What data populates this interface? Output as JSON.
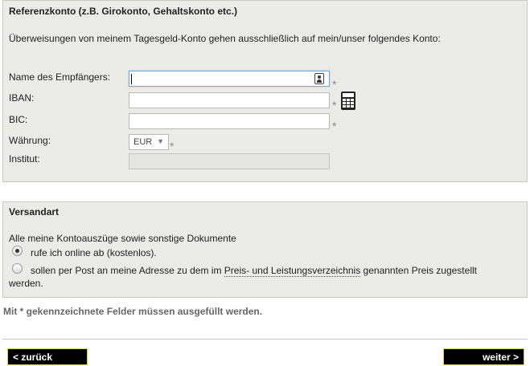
{
  "referenz": {
    "heading": "Referenzkonto (z.B. Girokonto, Gehaltskonto etc.)",
    "intro": "Überweisungen von meinem Tagesgeld-Konto gehen ausschließlich auf mein/unser folgendes Konto:",
    "fields": {
      "name_label": "Name des Empfängers:",
      "name_value": "",
      "iban_label": "IBAN:",
      "iban_value": "",
      "bic_label": "BIC:",
      "bic_value": "",
      "waehrung_label": "Währung:",
      "waehrung_value": "EUR",
      "institut_label": "Institut:",
      "institut_value": ""
    },
    "required_mark": "*"
  },
  "versand": {
    "heading": "Versandart",
    "intro": "Alle meine Kontoauszüge sowie sonstige Dokumente",
    "option_online": "rufe ich online ab (kostenlos).",
    "option_online_selected": true,
    "option_post_pre": "sollen per Post an meine Adresse zu dem im ",
    "option_post_link": "Preis- und Leistungsverzeichnis",
    "option_post_post": " genannten Preis zugestellt",
    "option_post_line2": "werden.",
    "option_post_selected": false
  },
  "note": {
    "pre": "Mit ",
    "star": "*",
    "post": " gekennzeichnete Felder müssen ausgefüllt werden."
  },
  "nav": {
    "back_label": "< zurück",
    "next_label": "weiter >"
  },
  "icons": {
    "contact": "contact-card-icon",
    "calculator": "calculator-icon",
    "select_arrow": "▼"
  },
  "colors": {
    "panel_bg": "#ebebe8",
    "button_bg": "#000000",
    "button_border": "#d7d24a",
    "focus_border": "#7aa7d8"
  }
}
